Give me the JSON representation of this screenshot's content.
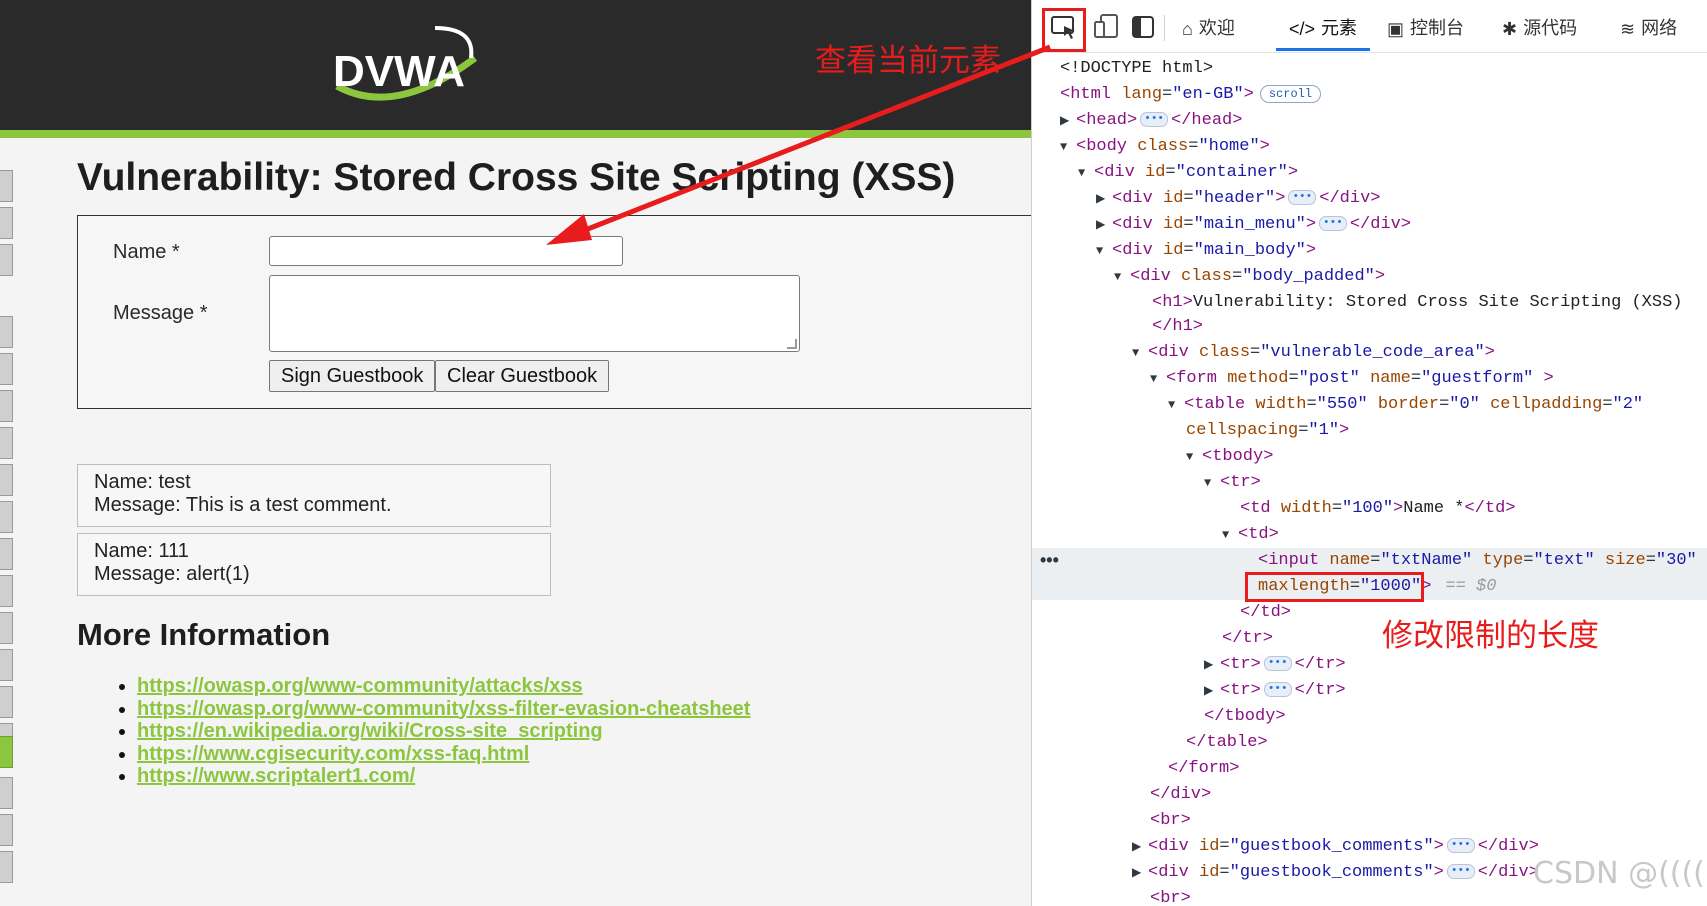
{
  "dvwa": {
    "logo_text": "DVWA",
    "page_title": "Vulnerability: Stored Cross Site Scripting (XSS)",
    "form": {
      "name_label": "Name *",
      "message_label": "Message *",
      "name_value": "",
      "message_value": "",
      "sign_button": "Sign Guestbook",
      "clear_button": "Clear Guestbook"
    },
    "comments": [
      {
        "name": "Name: test",
        "message": "Message: This is a test comment."
      },
      {
        "name": "Name: 111",
        "message": "Message: alert(1)"
      }
    ],
    "more_info_title": "More Information",
    "links": [
      "https://owasp.org/www-community/attacks/xss",
      "https://owasp.org/www-community/xss-filter-evasion-cheatsheet",
      "https://en.wikipedia.org/wiki/Cross-site_scripting",
      "https://www.cgisecurity.com/xss-faq.html",
      "https://www.scriptalert1.com/"
    ]
  },
  "devtools": {
    "tabs": [
      {
        "label": "欢迎",
        "icon": "home-icon"
      },
      {
        "label": "元素",
        "icon": "code-icon"
      },
      {
        "label": "控制台",
        "icon": "console-icon"
      },
      {
        "label": "源代码",
        "icon": "bug-icon"
      },
      {
        "label": "网络",
        "icon": "wifi-icon"
      }
    ],
    "active_tab": "元素",
    "scroll_badge": "scroll",
    "dollar_ref": "== $0",
    "selected_dots": "•••"
  },
  "annotations": {
    "inspect_label": "查看当前元素",
    "length_label": "修改限制的长度"
  },
  "watermark": "CSDN @(((((",
  "colors": {
    "dvwa_green": "#8cc63f",
    "annotation_red": "#e81c1c",
    "active_tab_blue": "#1a73e8"
  }
}
